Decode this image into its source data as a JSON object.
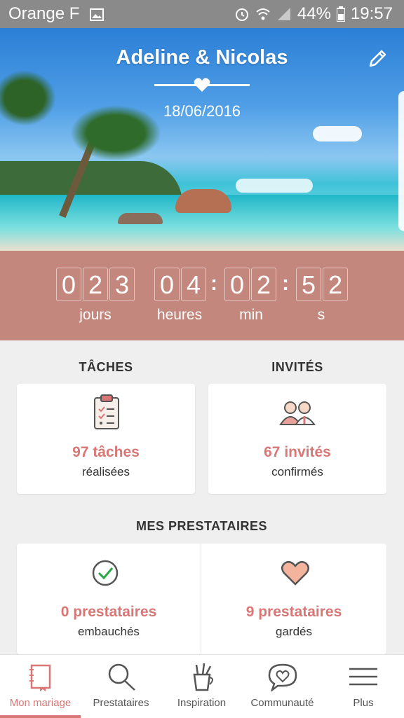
{
  "status_bar": {
    "carrier": "Orange F",
    "battery": "44%",
    "time": "19:57"
  },
  "header": {
    "names": "Adeline & Nicolas",
    "date": "18/06/2016"
  },
  "countdown": {
    "days_digits": [
      "0",
      "2",
      "3"
    ],
    "hours_digits": [
      "0",
      "4"
    ],
    "min_digits": [
      "0",
      "2"
    ],
    "sec_digits": [
      "5",
      "2"
    ],
    "separator": ":",
    "labels": {
      "days": "jours",
      "hours": "heures",
      "min": "min",
      "sec": "s"
    }
  },
  "tasks": {
    "title": "TÂCHES",
    "value": "97 tâches",
    "sub": "réalisées"
  },
  "guests": {
    "title": "INVITÉS",
    "value": "67 invités",
    "sub": "confirmés"
  },
  "vendors": {
    "title": "MES PRESTATAIRES",
    "hired_value": "0 prestataires",
    "hired_sub": "embauchés",
    "kept_value": "9 prestataires",
    "kept_sub": "gardés"
  },
  "nav": [
    {
      "label": "Mon mariage",
      "icon": "notebook-icon",
      "active": true
    },
    {
      "label": "Prestataires",
      "icon": "search-icon",
      "active": false
    },
    {
      "label": "Inspiration",
      "icon": "brush-cup-icon",
      "active": false
    },
    {
      "label": "Communauté",
      "icon": "chat-heart-icon",
      "active": false
    },
    {
      "label": "Plus",
      "icon": "menu-icon",
      "active": false
    }
  ],
  "colors": {
    "accent": "#d87775",
    "countdown_bg": "#c4877d",
    "status_bar": "#8a8a8a"
  }
}
